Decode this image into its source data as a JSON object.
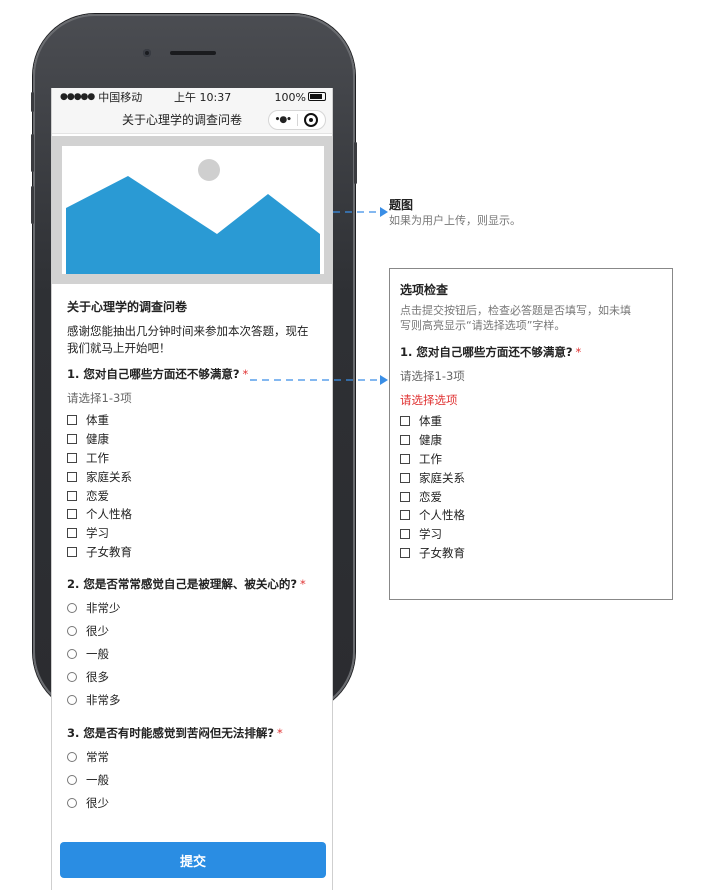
{
  "status_bar": {
    "signal": "●●●●●",
    "carrier": "中国移动",
    "time": "上午 10:37",
    "battery": "100%"
  },
  "navbar": {
    "title": "关于心理学的调查问卷",
    "more_icon": "•●•",
    "close_icon": "target-icon"
  },
  "survey": {
    "title": "关于心理学的调查问卷",
    "intro": "感谢您能抽出几分钟时间来参加本次答题，现在我们就马上开始吧！",
    "required_mark": "*",
    "q1": {
      "text": "1. 您对自己哪些方面还不够满意?",
      "hint": "请选择1-3项",
      "options": [
        "体重",
        "健康",
        "工作",
        "家庭关系",
        "恋爱",
        "个人性格",
        "学习",
        "子女教育"
      ]
    },
    "q2": {
      "text": "2. 您是否常常感觉自己是被理解、被关心的?",
      "options": [
        "非常少",
        "很少",
        "一般",
        "很多",
        "非常多"
      ]
    },
    "q3": {
      "text": "3. 您是否有时能感觉到苦闷但无法排解?",
      "options": [
        "常常",
        "一般",
        "很少"
      ]
    },
    "submit_label": "提交"
  },
  "annotations": {
    "image": {
      "title": "题图",
      "desc": "如果为用户上传，则显示。"
    },
    "check": {
      "title": "选项检查",
      "desc_line1": "点击提交按钮后，检查必答题是否填写，如未填",
      "desc_line2": "写则高亮显示“请选择选项”字样。",
      "question": "1. 您对自己哪些方面还不够满意?",
      "hint": "请选择1-3项",
      "error": "请选择选项",
      "options": [
        "体重",
        "健康",
        "工作",
        "家庭关系",
        "恋爱",
        "个人性格",
        "学习",
        "子女教育"
      ]
    }
  },
  "colors": {
    "accent": "#2a8de3",
    "error": "#e03333",
    "image_blue": "#2a9ad4",
    "arrow": "#3a8ee6"
  }
}
